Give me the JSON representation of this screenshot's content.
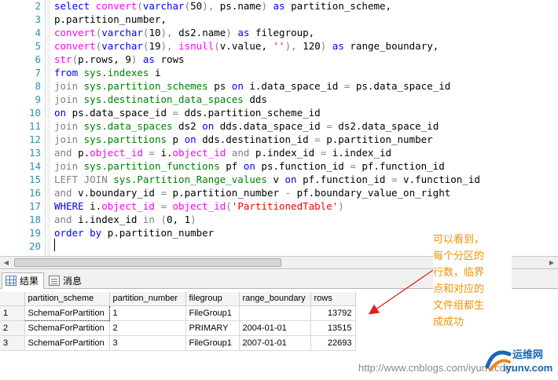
{
  "editor": {
    "lines": [
      {
        "n": "2",
        "segs": [
          [
            "kw",
            "select "
          ],
          [
            "fn",
            "convert"
          ],
          [
            "gr",
            "("
          ],
          [
            "kw",
            "varchar"
          ],
          [
            "gr",
            "("
          ],
          [
            "",
            "50"
          ],
          [
            "gr",
            "),"
          ],
          [
            "",
            " ps.name"
          ],
          [
            "gr",
            ")"
          ],
          [
            "kw",
            " as "
          ],
          [
            "",
            "partition_scheme,"
          ]
        ]
      },
      {
        "n": "3",
        "segs": [
          [
            "",
            "p.partition_number,"
          ]
        ]
      },
      {
        "n": "4",
        "segs": [
          [
            "fn",
            "convert"
          ],
          [
            "gr",
            "("
          ],
          [
            "kw",
            "varchar"
          ],
          [
            "gr",
            "("
          ],
          [
            "",
            "10"
          ],
          [
            "gr",
            "),"
          ],
          [
            "",
            " ds2.name"
          ],
          [
            "gr",
            ")"
          ],
          [
            "kw",
            " as "
          ],
          [
            "",
            "filegroup,"
          ]
        ]
      },
      {
        "n": "5",
        "segs": [
          [
            "fn",
            "convert"
          ],
          [
            "gr",
            "("
          ],
          [
            "kw",
            "varchar"
          ],
          [
            "gr",
            "("
          ],
          [
            "",
            "19"
          ],
          [
            "gr",
            "),"
          ],
          [
            "fn",
            " isnull"
          ],
          [
            "gr",
            "("
          ],
          [
            "",
            "v.value, "
          ],
          [
            "str",
            "''"
          ],
          [
            "gr",
            "),"
          ],
          [
            "",
            " 120"
          ],
          [
            "gr",
            ")"
          ],
          [
            "kw",
            " as "
          ],
          [
            "",
            "range_boundary,"
          ]
        ]
      },
      {
        "n": "6",
        "segs": [
          [
            "fn",
            "str"
          ],
          [
            "gr",
            "("
          ],
          [
            "",
            "p.rows, 9"
          ],
          [
            "gr",
            ")"
          ],
          [
            "kw",
            " as "
          ],
          [
            "",
            "rows"
          ]
        ]
      },
      {
        "n": "7",
        "segs": [
          [
            "kw",
            "from "
          ],
          [
            "sys",
            "sys.indexes"
          ],
          [
            "",
            " i"
          ]
        ]
      },
      {
        "n": "8",
        "segs": [
          [
            "gr",
            "join "
          ],
          [
            "sys",
            "sys.partition_schemes"
          ],
          [
            "",
            " ps "
          ],
          [
            "kw",
            "on "
          ],
          [
            "",
            "i.data_space_id "
          ],
          [
            "gr",
            "= "
          ],
          [
            "",
            "ps.data_space_id"
          ]
        ]
      },
      {
        "n": "9",
        "segs": [
          [
            "gr",
            "join "
          ],
          [
            "sys",
            "sys.destination_data_spaces"
          ],
          [
            "",
            " dds"
          ]
        ]
      },
      {
        "n": "10",
        "segs": [
          [
            "kw",
            "on "
          ],
          [
            "",
            "ps.data_space_id "
          ],
          [
            "gr",
            "= "
          ],
          [
            "",
            "dds.partition_scheme_id"
          ]
        ]
      },
      {
        "n": "11",
        "segs": [
          [
            "gr",
            "join "
          ],
          [
            "sys",
            "sys.data_spaces"
          ],
          [
            "",
            " ds2 "
          ],
          [
            "kw",
            "on "
          ],
          [
            "",
            "dds.data_space_id "
          ],
          [
            "gr",
            "= "
          ],
          [
            "",
            "ds2.data_space_id"
          ]
        ]
      },
      {
        "n": "12",
        "segs": [
          [
            "gr",
            "join "
          ],
          [
            "sys",
            "sys.partitions"
          ],
          [
            "",
            " p "
          ],
          [
            "kw",
            "on "
          ],
          [
            "",
            "dds.destination_id "
          ],
          [
            "gr",
            "= "
          ],
          [
            "",
            "p.partition_number"
          ]
        ]
      },
      {
        "n": "13",
        "segs": [
          [
            "gr",
            "and "
          ],
          [
            "",
            "p."
          ],
          [
            "fn",
            "object_id"
          ],
          [
            "gr",
            " = "
          ],
          [
            "",
            "i."
          ],
          [
            "fn",
            "object_id"
          ],
          [
            "gr",
            " and "
          ],
          [
            "",
            "p.index_id "
          ],
          [
            "gr",
            "= "
          ],
          [
            "",
            "i.index_id"
          ]
        ]
      },
      {
        "n": "14",
        "segs": [
          [
            "gr",
            "join "
          ],
          [
            "sys",
            "sys.partition_functions"
          ],
          [
            "",
            " pf "
          ],
          [
            "kw",
            "on "
          ],
          [
            "",
            "ps.function_id "
          ],
          [
            "gr",
            "= "
          ],
          [
            "",
            "pf.function_id"
          ]
        ]
      },
      {
        "n": "15",
        "segs": [
          [
            "gr",
            "LEFT JOIN "
          ],
          [
            "sys",
            "sys.Partition_Range_values"
          ],
          [
            "",
            " v "
          ],
          [
            "kw",
            "on "
          ],
          [
            "",
            "pf.function_id "
          ],
          [
            "gr",
            "= "
          ],
          [
            "",
            "v.function_id"
          ]
        ]
      },
      {
        "n": "16",
        "segs": [
          [
            "gr",
            "and "
          ],
          [
            "",
            "v.boundary_id "
          ],
          [
            "gr",
            "= "
          ],
          [
            "",
            "p.partition_number "
          ],
          [
            "gr",
            "- "
          ],
          [
            "",
            "pf.boundary_value_on_right"
          ]
        ]
      },
      {
        "n": "17",
        "segs": [
          [
            "kw",
            "WHERE "
          ],
          [
            "",
            "i."
          ],
          [
            "fn",
            "object_id"
          ],
          [
            "gr",
            " = "
          ],
          [
            "fn",
            "object_id"
          ],
          [
            "gr",
            "("
          ],
          [
            "str",
            "'PartitionedTable'"
          ],
          [
            "gr",
            ")"
          ]
        ]
      },
      {
        "n": "18",
        "segs": [
          [
            "gr",
            "and "
          ],
          [
            "",
            "i.index_id "
          ],
          [
            "gr",
            "in "
          ],
          [
            "gr",
            "("
          ],
          [
            "",
            "0, 1"
          ],
          [
            "gr",
            ")"
          ]
        ]
      },
      {
        "n": "19",
        "segs": [
          [
            "kw",
            "order by "
          ],
          [
            "",
            "p.partition_number"
          ]
        ]
      },
      {
        "n": "20",
        "segs": []
      },
      {
        "n": "21",
        "segs": []
      }
    ]
  },
  "tabs": {
    "results_label": "结果",
    "messages_label": "消息"
  },
  "grid": {
    "columns": [
      "partition_scheme",
      "partition_number",
      "filegroup",
      "range_boundary",
      "rows"
    ],
    "rows": [
      {
        "rn": "1",
        "cells": [
          "SchemaForPartition",
          "1",
          "FileGroup1",
          "",
          "13792"
        ]
      },
      {
        "rn": "2",
        "cells": [
          "SchemaForPartition",
          "2",
          "PRIMARY",
          "2004-01-01",
          "13515"
        ]
      },
      {
        "rn": "3",
        "cells": [
          "SchemaForPartition",
          "3",
          "FileGroup1",
          "2007-01-01",
          "22693"
        ]
      }
    ]
  },
  "annotation": {
    "lines": [
      "可以看到，",
      "每个分区的",
      "行数，临界",
      "点和对应的",
      "文件组都生",
      "成成功"
    ],
    "color": "#f39200"
  },
  "watermark": {
    "url": "http://www.cnblogs.com/iyunv.com",
    "logo_name": "运维网",
    "logo_domain": "iyunv.com"
  }
}
